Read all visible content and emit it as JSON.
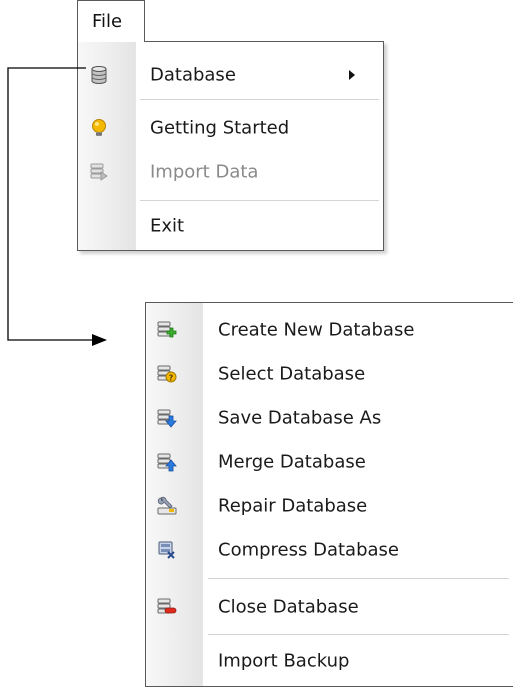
{
  "file_tab": {
    "label": "File"
  },
  "file_menu": {
    "items": [
      {
        "label": "Database",
        "icon": "database-icon",
        "has_submenu": true
      },
      {
        "label": "Getting Started",
        "icon": "lightbulb-icon"
      },
      {
        "label": "Import Data",
        "icon": "import-data-icon",
        "disabled": true
      },
      {
        "label": "Exit"
      }
    ]
  },
  "database_submenu": {
    "items": [
      {
        "label": "Create New Database",
        "icon": "create-database-icon"
      },
      {
        "label": "Select Database",
        "icon": "select-database-icon"
      },
      {
        "label": "Save Database As",
        "icon": "save-database-icon"
      },
      {
        "label": "Merge Database",
        "icon": "merge-database-icon"
      },
      {
        "label": "Repair Database",
        "icon": "repair-database-icon"
      },
      {
        "label": "Compress Database",
        "icon": "compress-database-icon"
      },
      {
        "label": "Close Database",
        "icon": "close-database-icon"
      },
      {
        "label": "Import Backup"
      }
    ]
  },
  "colors": {
    "border": "#5a5a5a",
    "disabled_text": "#8a8a8a",
    "separator": "#d4d4d4",
    "lightbulb": "#f5b800",
    "add_green": "#3cae2e",
    "help_yellow": "#f2b800",
    "arrow_blue": "#2a7ae0",
    "close_red": "#e02a1e"
  }
}
